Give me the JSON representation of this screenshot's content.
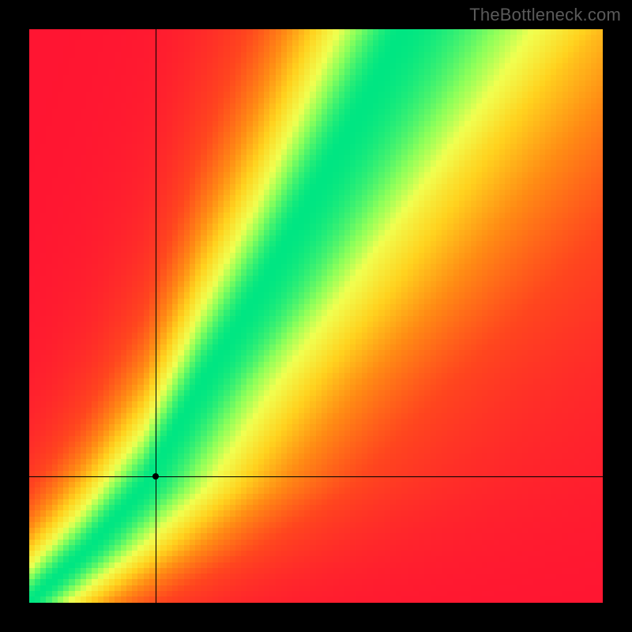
{
  "watermark": "TheBottleneck.com",
  "chart_data": {
    "type": "heatmap",
    "title": "",
    "xlabel": "",
    "ylabel": "",
    "xlim": [
      0,
      100
    ],
    "ylim": [
      0,
      100
    ],
    "grid_size": 100,
    "colorbar_labels": [],
    "color_scale": "red→orange→yellow→green (0=red=bad, 1=green=balanced)",
    "crosshair": {
      "x": 22,
      "y": 22
    },
    "data_description": "Compatibility/bottleneck score field over a 2D domain. Score ≈ 1 (green) along a curved ridge that is roughly y≈x for low values and y≈1.75x for high values; score falls off to 0 (red) away from the ridge, with a broader yellow shoulder on the upper-right side.",
    "ridge_samples": [
      {
        "x": 0,
        "y": 0
      },
      {
        "x": 10,
        "y": 9
      },
      {
        "x": 20,
        "y": 20
      },
      {
        "x": 30,
        "y": 38
      },
      {
        "x": 40,
        "y": 54
      },
      {
        "x": 50,
        "y": 72
      },
      {
        "x": 60,
        "y": 90
      },
      {
        "x": 65,
        "y": 100
      }
    ]
  }
}
